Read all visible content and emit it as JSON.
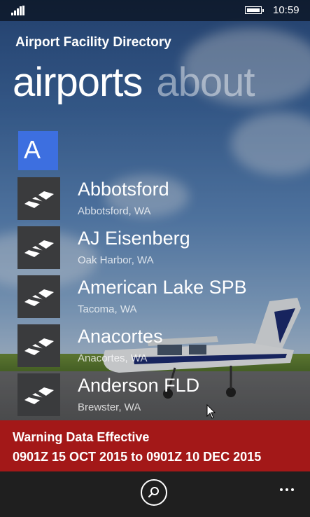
{
  "status_bar": {
    "time": "10:59"
  },
  "app": {
    "title": "Airport Facility Directory"
  },
  "pivot": {
    "tabs": [
      {
        "label": "airports",
        "active": true
      },
      {
        "label": "about",
        "active": false
      }
    ]
  },
  "group": {
    "letter": "A"
  },
  "airports": [
    {
      "name": "Abbotsford",
      "location": "Abbotsford, WA"
    },
    {
      "name": "AJ Eisenberg",
      "location": "Oak Harbor, WA"
    },
    {
      "name": "American Lake SPB",
      "location": "Tacoma, WA"
    },
    {
      "name": "Anacortes",
      "location": "Anacortes, WA"
    },
    {
      "name": "Anderson FLD",
      "location": "Brewster, WA"
    }
  ],
  "warning": {
    "line1": "Warning Data Effective",
    "line2": "0901Z 15 OCT 2015 to 0901Z 10 DEC 2015"
  },
  "colors": {
    "accent": "#3d6fe0",
    "warning_bg": "#a31818",
    "appbar_bg": "#1f1f1f",
    "tile_bg": "#3a3b3d"
  },
  "icons": {
    "airport_thumbnail": "runway-plane-icon",
    "search": "search-icon",
    "more": "more-icon"
  }
}
